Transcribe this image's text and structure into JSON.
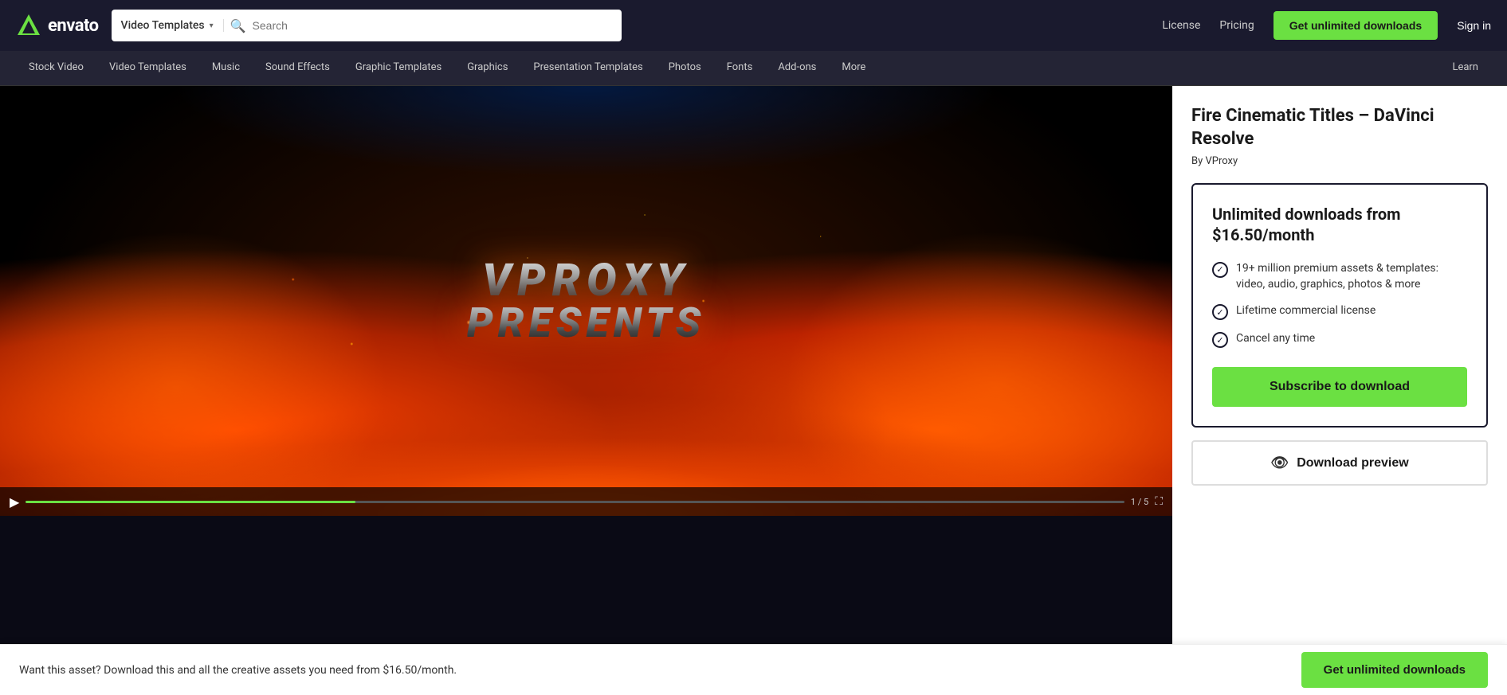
{
  "brand": {
    "name": "envato",
    "logo_color": "#6be042"
  },
  "topnav": {
    "category_selector": "Video Templates",
    "search_placeholder": "Search",
    "links": [
      {
        "id": "license",
        "label": "License"
      },
      {
        "id": "pricing",
        "label": "Pricing"
      }
    ],
    "cta_unlimited": "Get unlimited downloads",
    "signin": "Sign in"
  },
  "subnav": {
    "items": [
      {
        "id": "stock-video",
        "label": "Stock Video"
      },
      {
        "id": "video-templates",
        "label": "Video Templates"
      },
      {
        "id": "music",
        "label": "Music"
      },
      {
        "id": "sound-effects",
        "label": "Sound Effects"
      },
      {
        "id": "graphic-templates",
        "label": "Graphic Templates"
      },
      {
        "id": "graphics",
        "label": "Graphics"
      },
      {
        "id": "presentation-templates",
        "label": "Presentation Templates"
      },
      {
        "id": "photos",
        "label": "Photos"
      },
      {
        "id": "fonts",
        "label": "Fonts"
      },
      {
        "id": "add-ons",
        "label": "Add-ons"
      },
      {
        "id": "more",
        "label": "More"
      }
    ],
    "learn": "Learn"
  },
  "video": {
    "title_line1": "VPROXY",
    "title_line2": "PRESENTS",
    "time_label": "1 / 5",
    "progress_pct": 30
  },
  "product": {
    "title": "Fire Cinematic Titles – DaVinci Resolve",
    "author_prefix": "By",
    "author": "VProxy",
    "pricing_headline": "Unlimited downloads from $16.50/month",
    "features": [
      {
        "id": "assets",
        "text": "19+ million premium assets & templates: video, audio, graphics, photos & more"
      },
      {
        "id": "license",
        "text": "Lifetime commercial license"
      },
      {
        "id": "cancel",
        "text": "Cancel any time"
      }
    ],
    "btn_subscribe": "Subscribe to download",
    "btn_download_preview": "Download preview"
  },
  "bottom_bar": {
    "text": "Want this asset? Download this and all the creative assets you need from $16.50/month.",
    "btn_label": "Get unlimited downloads"
  }
}
